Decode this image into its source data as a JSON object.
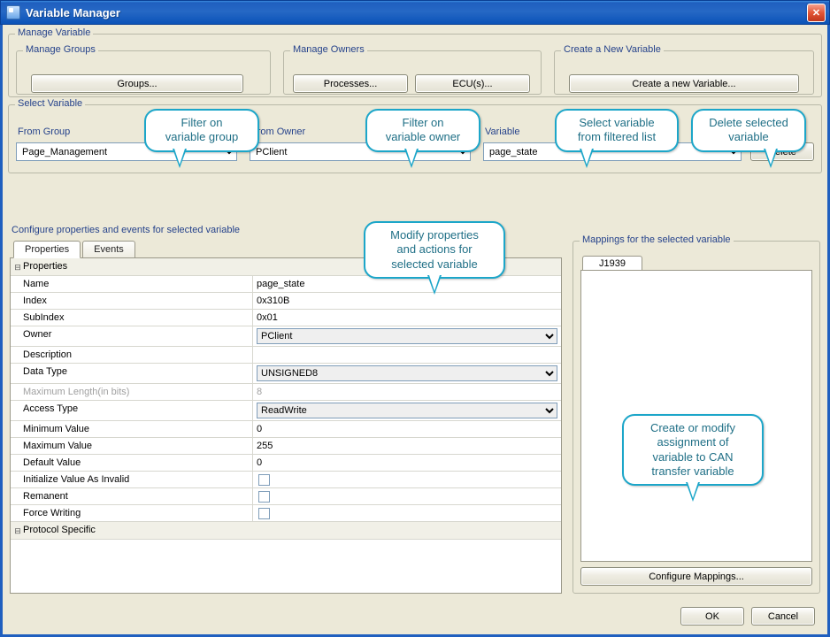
{
  "window": {
    "title": "Variable Manager"
  },
  "manage": {
    "legend": "Manage Variable",
    "groups": {
      "legend": "Manage Groups",
      "button": "Groups..."
    },
    "owners": {
      "legend": "Manage Owners",
      "processes": "Processes...",
      "ecus": "ECU(s)..."
    },
    "create": {
      "legend": "Create a New Variable",
      "button": "Create a new Variable..."
    }
  },
  "select": {
    "legend": "Select Variable",
    "group": {
      "label": "From Group",
      "value": "Page_Management"
    },
    "owner": {
      "label": "From Owner",
      "value": "PClient"
    },
    "variable": {
      "label": "Variable",
      "value": "page_state",
      "delete": "Delete"
    }
  },
  "configure": {
    "title": "Configure properties and events for selected variable",
    "tabs": {
      "properties": "Properties",
      "events": "Events"
    },
    "propertiesGroup": "Properties",
    "rows": {
      "name": {
        "label": "Name",
        "value": "page_state"
      },
      "index": {
        "label": "Index",
        "value": "0x310B"
      },
      "subindex": {
        "label": "SubIndex",
        "value": "0x01"
      },
      "owner": {
        "label": "Owner",
        "value": "PClient"
      },
      "description": {
        "label": "Description",
        "value": ""
      },
      "datatype": {
        "label": "Data Type",
        "value": "UNSIGNED8"
      },
      "maxlen": {
        "label": "Maximum Length(in bits)",
        "value": "8"
      },
      "access": {
        "label": "Access Type",
        "value": "ReadWrite"
      },
      "min": {
        "label": "Minimum Value",
        "value": "0"
      },
      "max": {
        "label": "Maximum Value",
        "value": "255"
      },
      "def": {
        "label": "Default Value",
        "value": "0"
      },
      "initinvalid": {
        "label": "Initialize Value As Invalid"
      },
      "remanent": {
        "label": "Remanent"
      },
      "force": {
        "label": "Force Writing"
      }
    },
    "protocolGroup": "Protocol Specific"
  },
  "mappings": {
    "legend": "Mappings for the selected variable",
    "tab": "J1939",
    "button": "Configure Mappings..."
  },
  "buttons": {
    "ok": "OK",
    "cancel": "Cancel"
  },
  "callouts": {
    "c1": "Filter on\nvariable group",
    "c2": "Filter on\nvariable owner",
    "c3": "Select variable\nfrom filtered list",
    "c4": "Delete selected\nvariable",
    "c5": "Modify properties\nand actions for\nselected variable",
    "c6": "Create or modify\nassignment of\nvariable to CAN\ntransfer variable"
  }
}
